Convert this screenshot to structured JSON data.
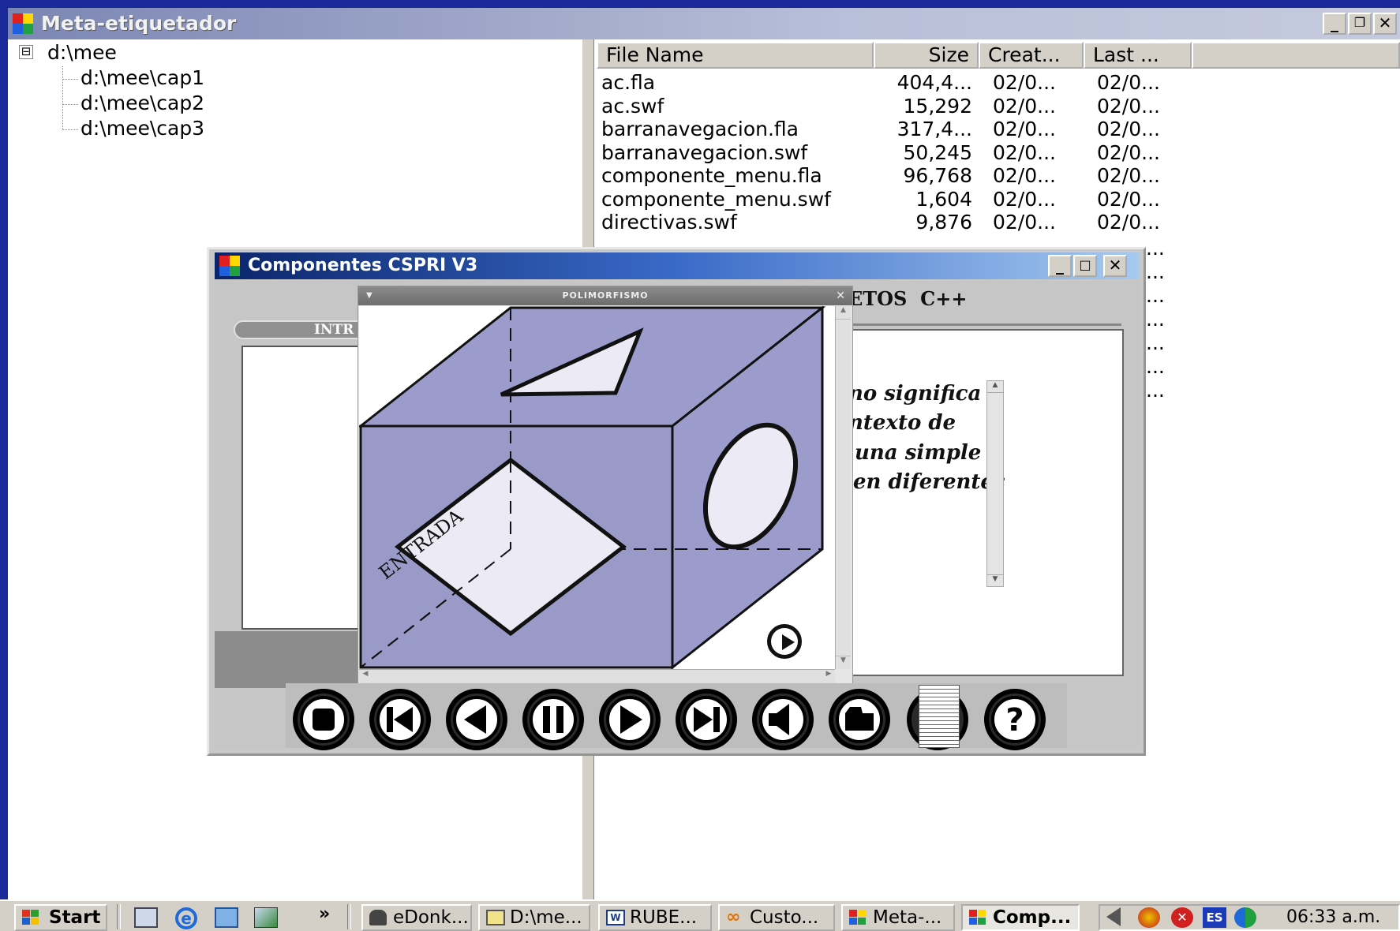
{
  "app": {
    "title": "Meta-etiquetador"
  },
  "tree": {
    "root": "d:\\mee",
    "expander": "⊟",
    "children": [
      "d:\\mee\\cap1",
      "d:\\mee\\cap2",
      "d:\\mee\\cap3"
    ]
  },
  "file_list": {
    "columns": [
      "File Name",
      "Size",
      "Creat...",
      "Last ..."
    ],
    "rows": [
      {
        "name": "ac.fla",
        "size": "404,4...",
        "created": "02/0...",
        "last": "02/0..."
      },
      {
        "name": "ac.swf",
        "size": "15,292",
        "created": "02/0...",
        "last": "02/0..."
      },
      {
        "name": "barranavegacion.fla",
        "size": "317,4...",
        "created": "02/0...",
        "last": "02/0..."
      },
      {
        "name": "barranavegacion.swf",
        "size": "50,245",
        "created": "02/0...",
        "last": "02/0..."
      },
      {
        "name": "componente_menu.fla",
        "size": "96,768",
        "created": "02/0...",
        "last": "02/0..."
      },
      {
        "name": "componente_menu.swf",
        "size": "1,604",
        "created": "02/0...",
        "last": "02/0..."
      },
      {
        "name": "directivas.swf",
        "size": "9,876",
        "created": "02/0...",
        "last": "02/0..."
      }
    ],
    "hidden_rows_last_col": "..."
  },
  "componentes": {
    "title": "Componentes CSPRI V3",
    "heading_fragment": "ETOS  C++",
    "tab_fragment": "INTR",
    "text_lines": [
      "no significa",
      "ntexto de",
      "una simple",
      "en diferentes"
    ]
  },
  "polimorfismo": {
    "title": "POLIMORFISMO",
    "diagram_label": "ENTRADA"
  },
  "controls": [
    "stop",
    "first",
    "previous",
    "pause",
    "play",
    "last",
    "volume",
    "folder",
    "index",
    "help"
  ],
  "help_glyph": "?",
  "taskbar": {
    "start": "Start",
    "chevron": "»",
    "tasks": [
      "eDonk...",
      "D:\\me...",
      "RUBE...",
      "Custo...",
      "Meta-...",
      "Comp..."
    ],
    "lang": "ES",
    "clock": "06:33 a.m."
  },
  "colors": {
    "cube_face": "#9c9ccc",
    "cube_light": "#ecebf5",
    "window_title": "#0a246a"
  }
}
